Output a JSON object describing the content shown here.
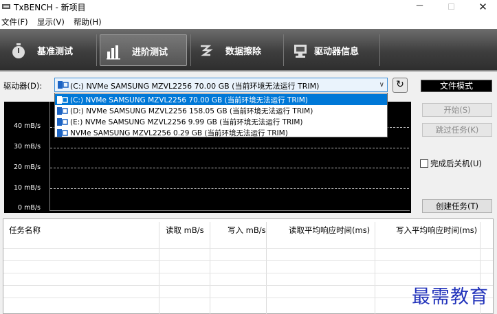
{
  "window": {
    "title": "TxBENCH - 新项目",
    "minimize_icon": "－",
    "maximize_icon": "☐",
    "close_icon": "✕"
  },
  "menu": {
    "items": [
      "文件(F)",
      "显示(V)",
      "帮助(H)"
    ]
  },
  "toolbar": {
    "tabs": [
      {
        "label": "基准测试",
        "icon": "stopwatch-icon",
        "active": false
      },
      {
        "label": "进阶测试",
        "icon": "bar-chart-icon",
        "active": true
      },
      {
        "label": "数据擦除",
        "icon": "erase-icon",
        "active": false
      },
      {
        "label": "驱动器信息",
        "icon": "drive-info-icon",
        "active": false
      }
    ]
  },
  "drive": {
    "label": "驱动器(D):",
    "selected": "(C:) NVMe SAMSUNG MZVL2256  70.00 GB (当前环境无法运行 TRIM)",
    "options": [
      "(C:) NVMe SAMSUNG MZVL2256  70.00 GB (当前环境无法运行 TRIM)",
      "(D:) NVMe SAMSUNG MZVL2256  158.05 GB (当前环境无法运行 TRIM)",
      "(E:) NVMe SAMSUNG MZVL2256  9.99 GB (当前环境无法运行 TRIM)",
      "NVMe SAMSUNG MZVL2256  0.29 GB (当前环境无法运行 TRIM)"
    ],
    "refresh_icon": "↻",
    "dropdown_icon": "∨"
  },
  "chart": {
    "y_ticks": [
      "40 mB/s",
      "30 mB/s",
      "20 mB/s",
      "10 mB/s",
      "0 mB/s"
    ]
  },
  "right_panel": {
    "file_mode": "文件模式",
    "start": "开始(S)",
    "skip_task": "跳过任务(K)",
    "shutdown_after": "完成后关机(U)",
    "create_task": "创建任务(T)"
  },
  "table": {
    "columns": [
      "任务名称",
      "读取 mB/s",
      "写入 mB/s",
      "读取平均响应时间(ms)",
      "写入平均响应时间(ms)"
    ]
  },
  "watermark": "最需教育",
  "colors": {
    "accent": "#0078d7",
    "toolbar_dark": "#3e3e3e",
    "watermark": "#2233bb"
  }
}
